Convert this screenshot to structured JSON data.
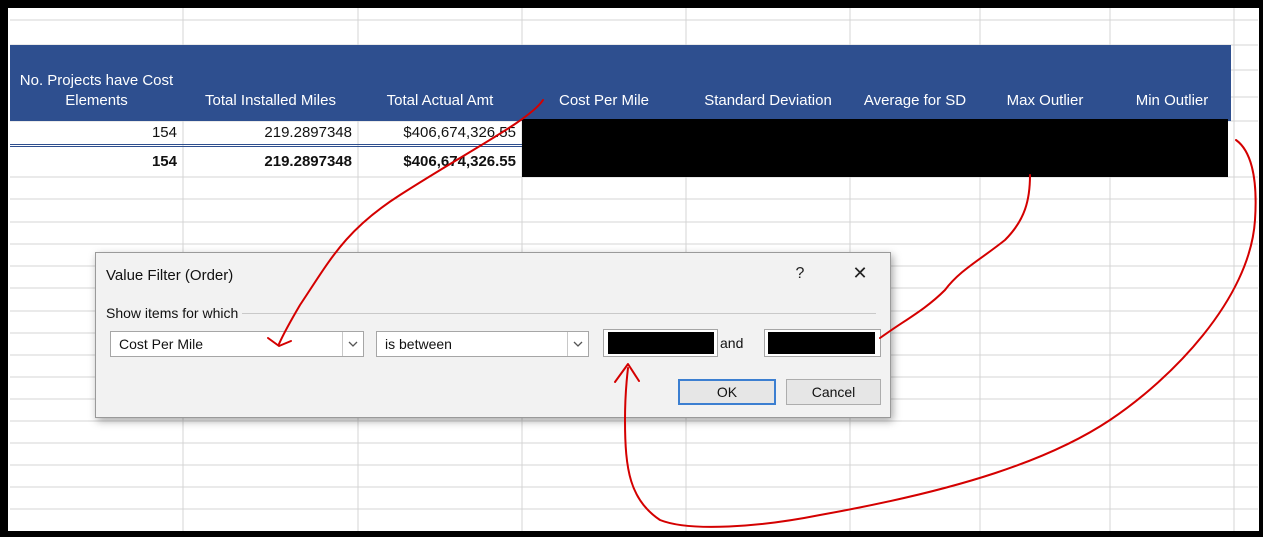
{
  "headers": [
    {
      "text": "No. Projects have Cost Elements"
    },
    {
      "text": "Total Installed Miles"
    },
    {
      "text": "Total Actual Amt"
    },
    {
      "text": "Cost Per Mile"
    },
    {
      "text": "Standard Deviation"
    },
    {
      "text": "Average for SD"
    },
    {
      "text": "Max Outlier"
    },
    {
      "text": "Min Outlier"
    }
  ],
  "rows": [
    {
      "projects": "154",
      "miles": "219.2897348",
      "amount": "$406,674,326.55"
    },
    {
      "projects": "154",
      "miles": "219.2897348",
      "amount": "$406,674,326.55"
    }
  ],
  "dialog": {
    "title": "Value Filter (Order)",
    "help": "?",
    "close": "✕",
    "group_label": "Show items for which",
    "field_value": "Cost Per Mile",
    "operator_value": "is between",
    "and_label": "and",
    "ok_label": "OK",
    "cancel_label": "Cancel"
  },
  "colors": {
    "header_fill": "#2e4f8f",
    "annotation": "#d40000",
    "ok_border": "#3c7fd1"
  },
  "icons": {
    "dropdown": "chevron-down-icon",
    "close": "close-icon"
  }
}
